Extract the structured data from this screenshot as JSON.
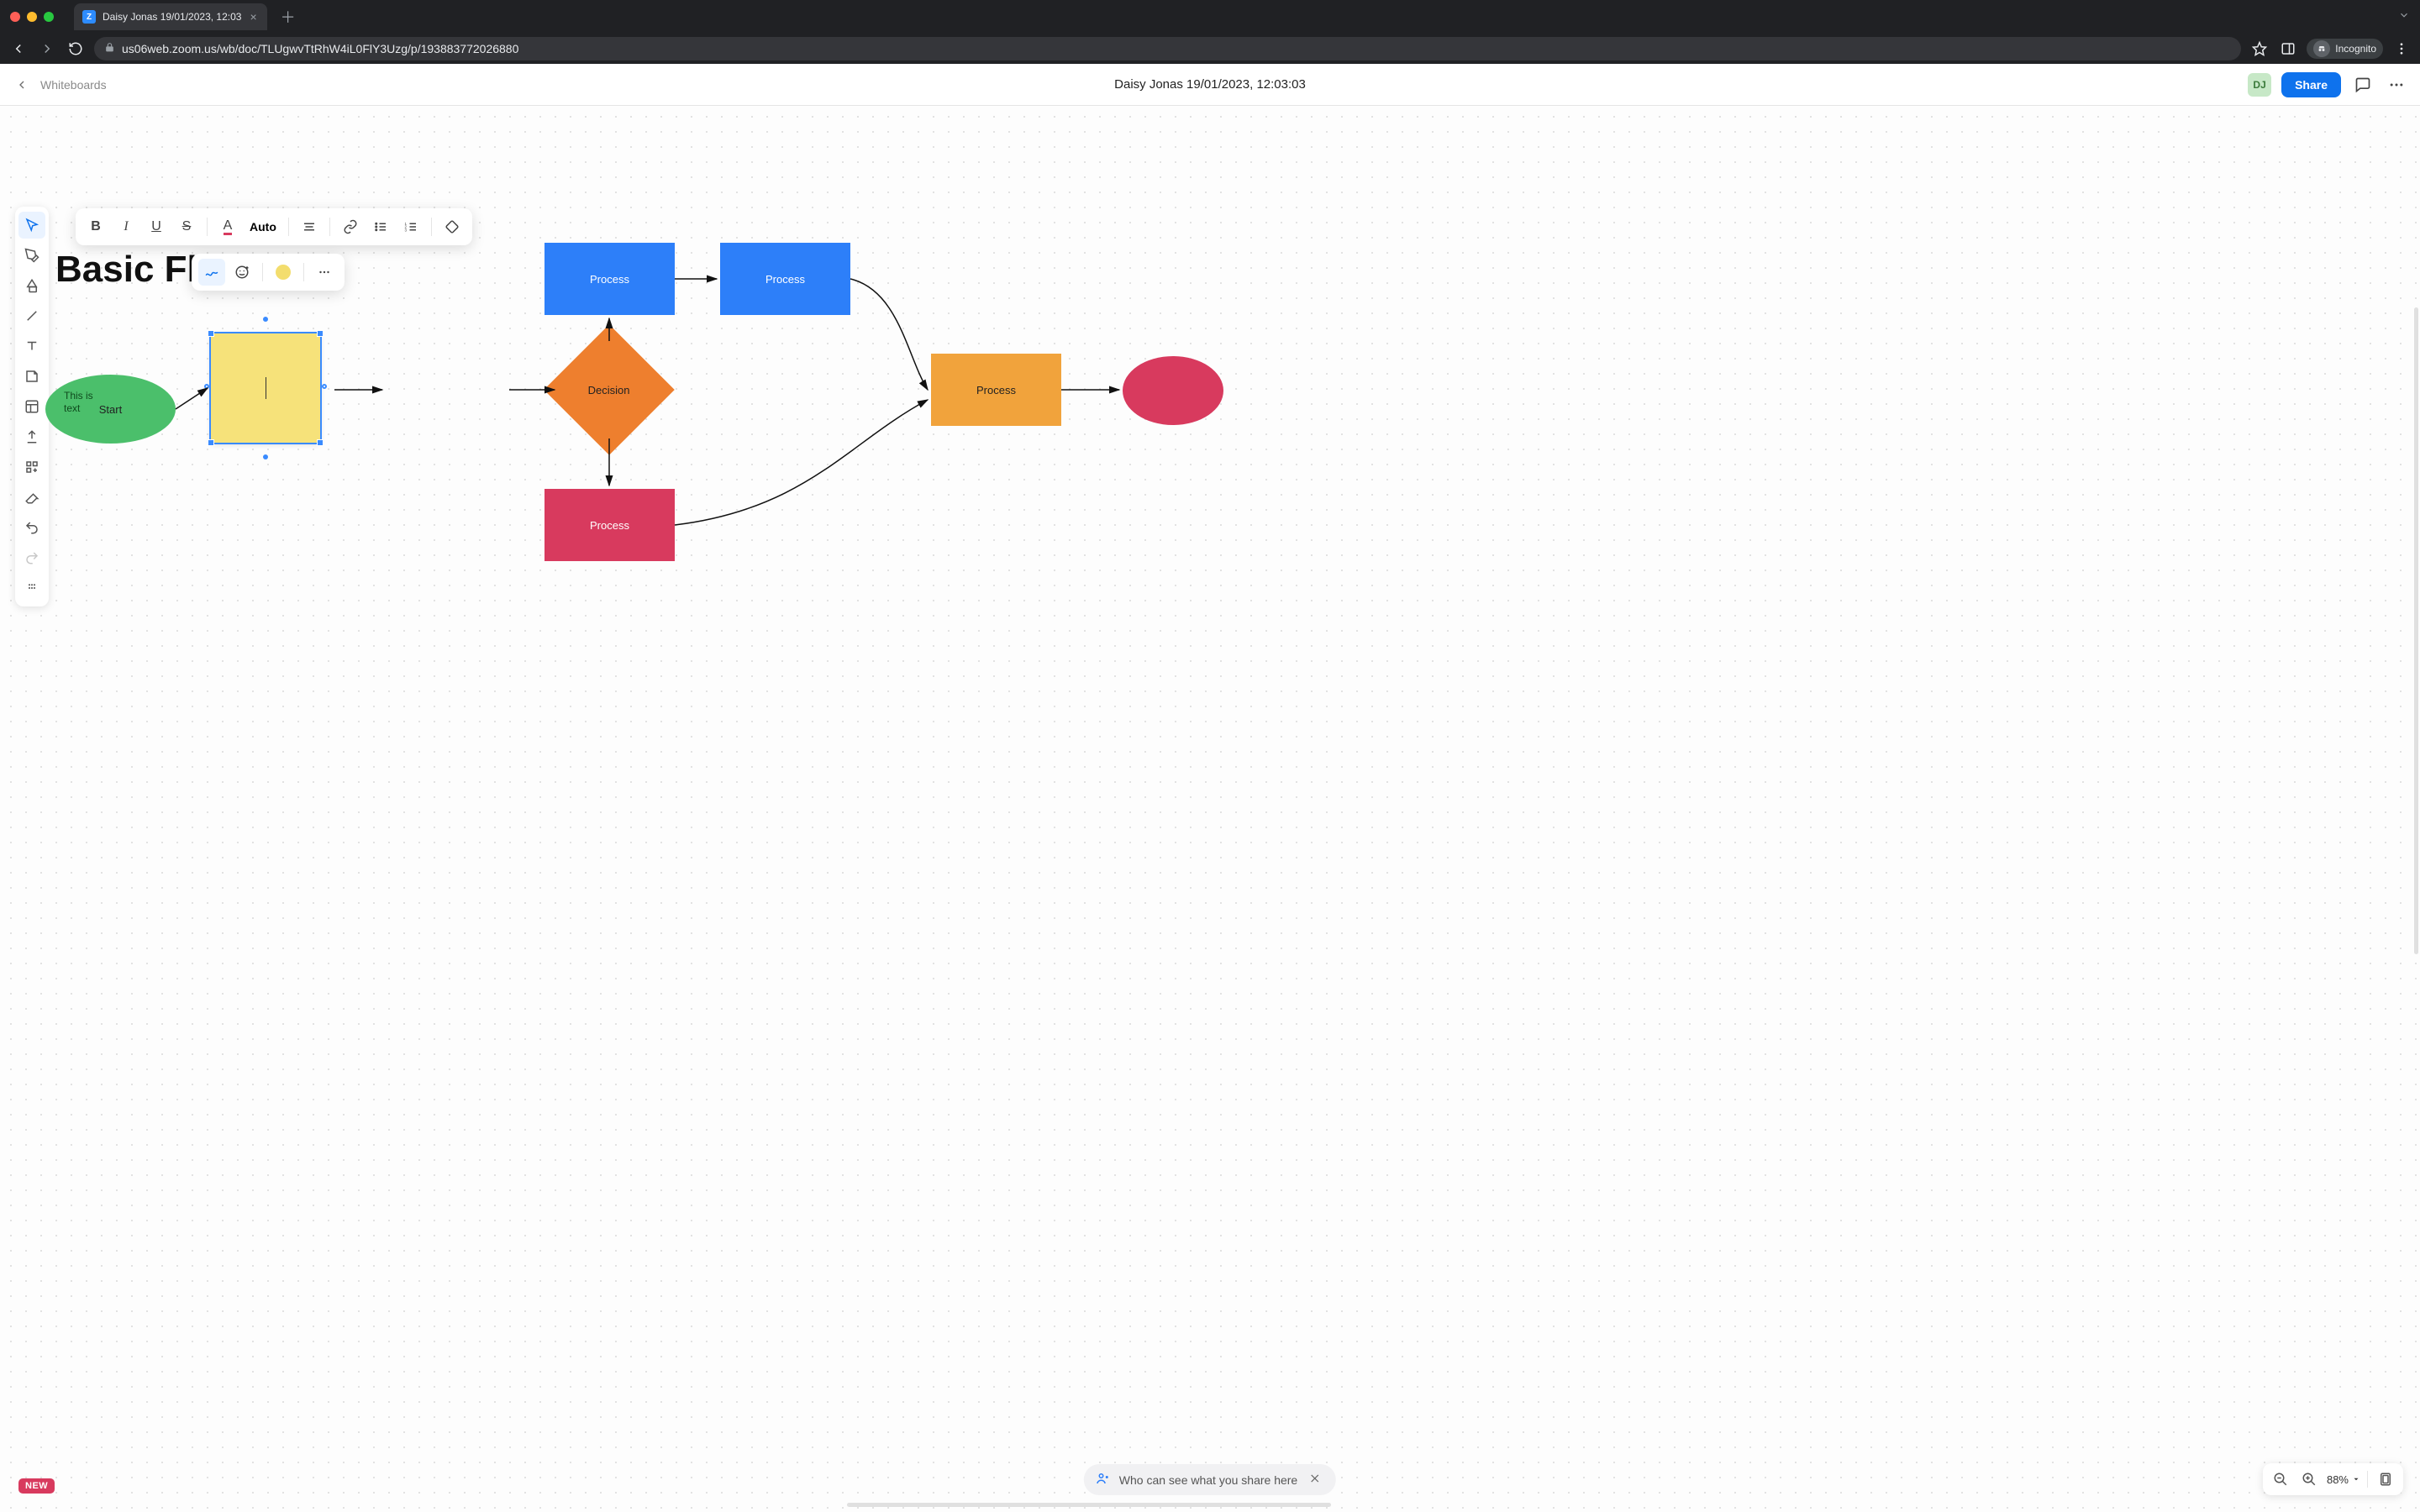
{
  "browser": {
    "tab_title": "Daisy Jonas 19/01/2023, 12:03",
    "url": "us06web.zoom.us/wb/doc/TLUgwvTtRhW4iL0FlY3Uzg/p/193883772026880",
    "incognito_label": "Incognito"
  },
  "header": {
    "breadcrumb": "Whiteboards",
    "doc_title": "Daisy Jonas 19/01/2023, 12:03:03",
    "avatar_initials": "DJ",
    "share_label": "Share"
  },
  "text_toolbar": {
    "auto_label": "Auto"
  },
  "colors": {
    "sticky_swatch": "#f3dd6d"
  },
  "canvas": {
    "title": "Basic Fl",
    "sticky_caret": "I",
    "oval_start": {
      "label": "Start",
      "extra_line1": "This is",
      "extra_line2": "text"
    },
    "process_blue1": "Process",
    "process_blue2": "Process",
    "decision": "Decision",
    "process_pink": "Process",
    "process_amber": "Process"
  },
  "zoom": {
    "level": "88%"
  },
  "privacy_banner": "Who can see what you share here",
  "badge_new": "NEW"
}
